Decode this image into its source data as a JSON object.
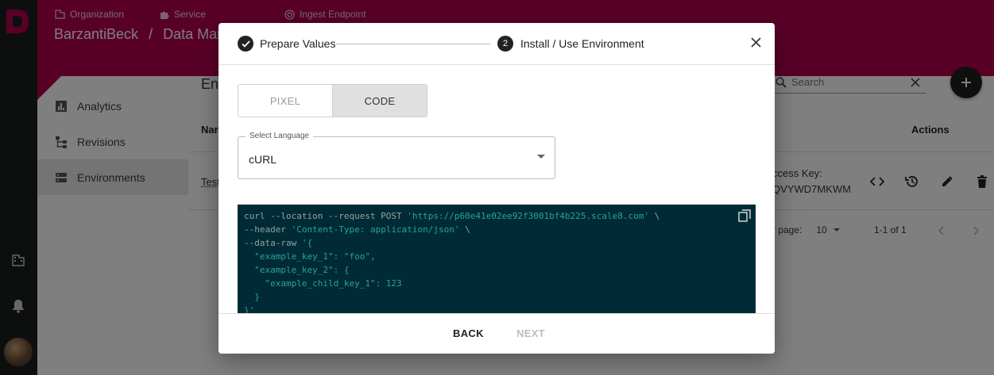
{
  "header": {
    "breadcrumbs": [
      {
        "label": "Organization",
        "icon": "building-icon"
      },
      {
        "label": "Service",
        "icon": "puzzle-icon"
      },
      {
        "label": "Ingest Endpoint",
        "icon": "target-icon"
      }
    ],
    "title_org": "BarzantiBeck",
    "title_sep": "/",
    "title_page": "Data Mana"
  },
  "nav": {
    "items": [
      {
        "label": "Analytics",
        "icon": "bar-chart-icon"
      },
      {
        "label": "Revisions",
        "icon": "tree-icon"
      },
      {
        "label": "Environments",
        "icon": "storage-icon",
        "active": true
      }
    ]
  },
  "main": {
    "page_title": "En",
    "search_placeholder": "Search",
    "table": {
      "col_name": "Nar",
      "col_actions": "Actions",
      "row_name": "Test",
      "access_key_label": "ccess Key:",
      "access_key_value": "QVYWD7MKWM"
    },
    "pagination": {
      "rows_label": "r page:",
      "rows_value": "10",
      "range": "1-1 of 1"
    }
  },
  "modal": {
    "steps": [
      {
        "label": "Prepare Values",
        "state": "done"
      },
      {
        "label": "Install / Use Environment",
        "number": "2",
        "state": "active"
      }
    ],
    "toggle": {
      "options": [
        "PIXEL",
        "CODE"
      ],
      "selected": "CODE"
    },
    "language": {
      "legend": "Select Language",
      "value": "cURL"
    },
    "code": {
      "line1_cmd": "curl --location --request POST ",
      "line1_url": "'https://p60e41e02ee92f3001bf4b225.scale8.com'",
      "line1_end": " \\",
      "line2_cmd": "--header ",
      "line2_val": "'Content-Type: application/json'",
      "line2_end": " \\",
      "line3_cmd": "--data-raw ",
      "line3_val": "'{",
      "line4": "  \"example_key_1\": \"foo\",",
      "line5": "  \"example_key_2\": {",
      "line6": "    \"example_child_key_1\": 123",
      "line7": "  }",
      "line8": "}'"
    },
    "footer": {
      "back": "BACK",
      "next": "NEXT"
    }
  },
  "colors": {
    "brand": "#b3004e",
    "rail": "#1a1f1f",
    "code_bg": "#002b36",
    "code_string": "#2aa198"
  }
}
